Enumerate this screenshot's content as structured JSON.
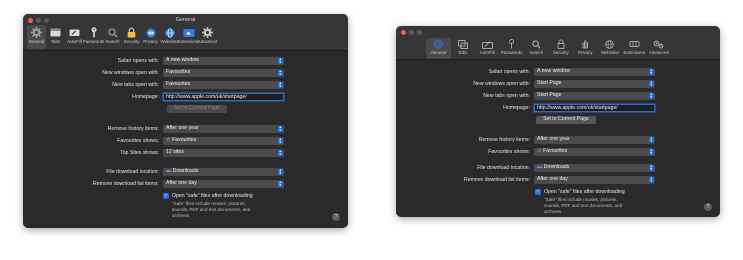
{
  "colors": {
    "window_bg": "#2a2a2c",
    "titlebar_bg": "#363638",
    "accent": "#1e6fe0",
    "close_button": "#ec5f57"
  },
  "window_left": {
    "title": "General",
    "toolbar": [
      {
        "label": "General",
        "icon": "gear-icon"
      },
      {
        "label": "Tabs",
        "icon": "tabs-icon"
      },
      {
        "label": "AutoFill",
        "icon": "autofill-icon"
      },
      {
        "label": "Passwords",
        "icon": "key-icon"
      },
      {
        "label": "Search",
        "icon": "magnifier-icon"
      },
      {
        "label": "Security",
        "icon": "lock-icon"
      },
      {
        "label": "Privacy",
        "icon": "privacy-icon"
      },
      {
        "label": "Websites",
        "icon": "globe-icon"
      },
      {
        "label": "Extensions",
        "icon": "puzzle-icon"
      },
      {
        "label": "Advanced",
        "icon": "gear-icon"
      }
    ],
    "safari_opens_with": {
      "label": "Safari opens with:",
      "value": "A new window"
    },
    "new_windows_open_with": {
      "label": "New windows open with:",
      "value": "Favourites"
    },
    "new_tabs_open_with": {
      "label": "New tabs open with:",
      "value": "Favourites"
    },
    "homepage": {
      "label": "Homepage:",
      "value": "http://www.apple.com/uk/startpage/"
    },
    "set_current_button": "Set to Current Page",
    "remove_history": {
      "label": "Remove history items:",
      "value": "After one year"
    },
    "favourites_shows": {
      "label": "Favourites shows:",
      "value": "☆ Favourites"
    },
    "top_sites_shows": {
      "label": "Top Sites shows:",
      "value": "12 sites"
    },
    "download_location": {
      "label": "File download location:",
      "value": "Downloads"
    },
    "remove_download_items": {
      "label": "Remove download list items:",
      "value": "After one day"
    },
    "open_safe_files": "Open \"safe\" files after downloading",
    "safe_note": [
      "\"Safe\" files include movies, pictures,",
      "sounds, PDF and text documents, and",
      "archives."
    ],
    "help": "?"
  },
  "window_right": {
    "toolbar": [
      {
        "label": "General",
        "icon": "general-icon"
      },
      {
        "label": "Tabs",
        "icon": "tabs-icon"
      },
      {
        "label": "AutoFill",
        "icon": "autofill-icon"
      },
      {
        "label": "Passwords",
        "icon": "key-icon"
      },
      {
        "label": "Search",
        "icon": "magnifier-icon"
      },
      {
        "label": "Security",
        "icon": "lock-icon"
      },
      {
        "label": "Privacy",
        "icon": "hand-icon"
      },
      {
        "label": "Websites",
        "icon": "globe-icon"
      },
      {
        "label": "Extensions",
        "icon": "puzzle-icon"
      },
      {
        "label": "Advanced",
        "icon": "gears-icon"
      }
    ],
    "safari_opens_with": {
      "label": "Safari opens with:",
      "value": "A new window"
    },
    "new_windows_open_with": {
      "label": "New windows open with:",
      "value": "Start Page"
    },
    "new_tabs_open_with": {
      "label": "New tabs open with:",
      "value": "Start Page"
    },
    "homepage": {
      "label": "Homepage:",
      "value": "http://www.apple.com/uk/startpage/"
    },
    "set_current_button": "Set to Current Page",
    "remove_history": {
      "label": "Remove history items:",
      "value": "After one year"
    },
    "favourites_shows": {
      "label": "Favourites shows:",
      "value": "☆ Favourites"
    },
    "download_location": {
      "label": "File download location:",
      "value": "Downloads"
    },
    "remove_download_items": {
      "label": "Remove download list items:",
      "value": "After one day"
    },
    "open_safe_files": "Open \"safe\" files after downloading",
    "safe_note": [
      "\"Safe\" files include movies, pictures,",
      "sounds, PDF and text documents, and",
      "archives."
    ],
    "help": "?"
  }
}
